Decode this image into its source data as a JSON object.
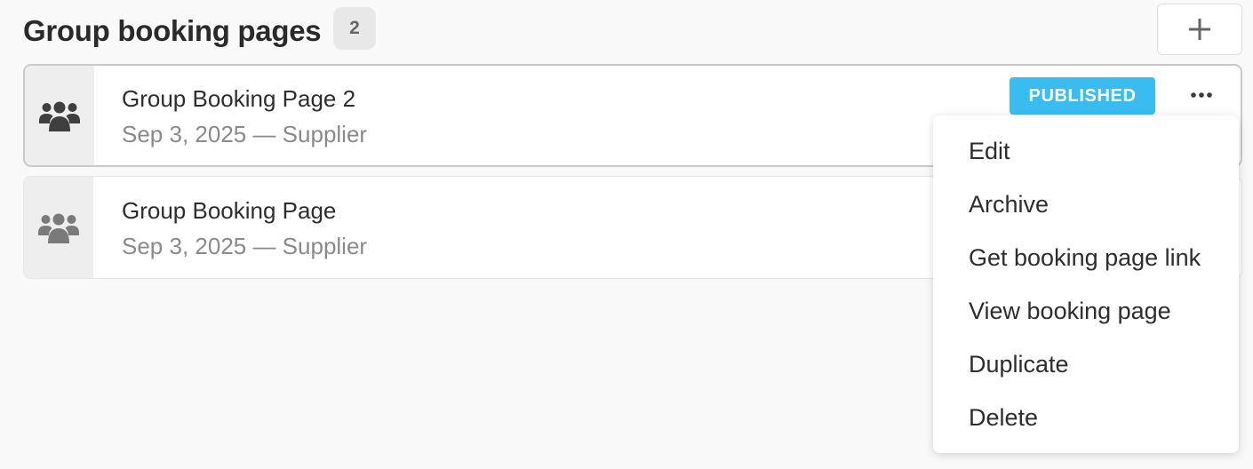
{
  "header": {
    "title": "Group booking pages",
    "count": "2",
    "add_icon": "plus-icon"
  },
  "pages": [
    {
      "title": "Group Booking Page 2",
      "meta": "Sep 3, 2025 — Supplier",
      "status": "PUBLISHED",
      "icon": "group-icon"
    },
    {
      "title": "Group Booking Page",
      "meta": "Sep 3, 2025 — Supplier",
      "icon": "group-icon"
    }
  ],
  "menu": {
    "items": [
      "Edit",
      "Archive",
      "Get booking page link",
      "View booking page",
      "Duplicate",
      "Delete"
    ]
  },
  "colors": {
    "status_published": "#39bdf0",
    "background": "#f9f9f9",
    "icon_panel": "#eeeeee"
  }
}
